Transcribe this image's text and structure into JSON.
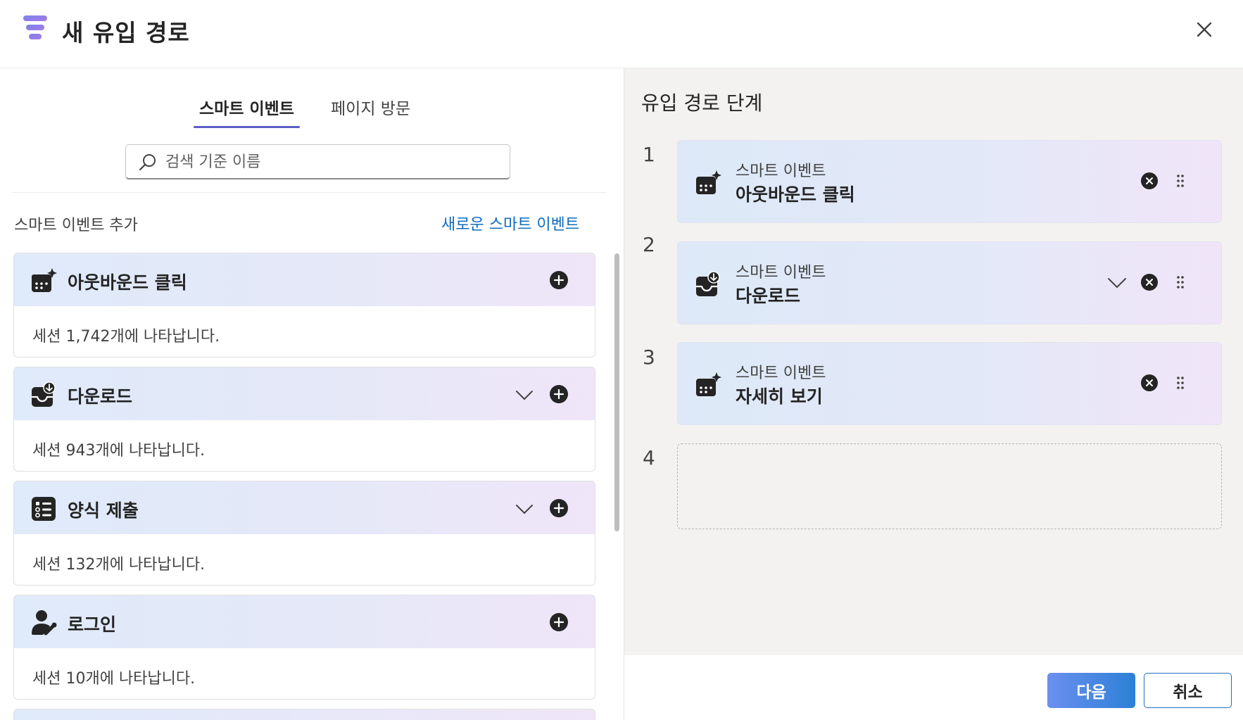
{
  "header": {
    "title": "새 유입 경로",
    "logo_icon": "funnel-icon",
    "close_icon": "close-icon"
  },
  "left_panel": {
    "tabs": [
      {
        "label": "스마트 이벤트",
        "active": true
      },
      {
        "label": "페이지 방문",
        "active": false
      }
    ],
    "search": {
      "placeholder": "검색 기준 이름",
      "value": "",
      "icon": "search-icon"
    },
    "section_label": "스마트 이벤트 추가",
    "new_link": "새로운 스마트 이벤트",
    "events": [
      {
        "title": "아웃바운드 클릭",
        "sessions": "세션 1,742개에 나타납니다.",
        "icon": "calendar-sparkle-icon",
        "expandable": false
      },
      {
        "title": "다운로드",
        "sessions": "세션 943개에 나타납니다.",
        "icon": "download-box-icon",
        "expandable": true
      },
      {
        "title": "양식 제출",
        "sessions": "세션 132개에 나타납니다.",
        "icon": "form-icon",
        "expandable": true
      },
      {
        "title": "로그인",
        "sessions": "세션 10개에 나타납니다.",
        "icon": "person-key-icon",
        "expandable": false
      }
    ]
  },
  "right_panel": {
    "title": "유입 경로 단계",
    "steps": [
      {
        "number": "1",
        "category": "스마트 이벤트",
        "title": "아웃바운드 클릭",
        "icon": "calendar-sparkle-icon",
        "expandable": false
      },
      {
        "number": "2",
        "category": "스마트 이벤트",
        "title": "다운로드",
        "icon": "download-box-icon",
        "expandable": true
      },
      {
        "number": "3",
        "category": "스마트 이벤트",
        "title": "자세히 보기",
        "icon": "calendar-sparkle-icon",
        "expandable": false
      }
    ],
    "empty_step_number": "4"
  },
  "footer": {
    "next_label": "다음",
    "cancel_label": "취소"
  },
  "colors": {
    "accent": "#5b5fc7",
    "link": "#0f6cbd",
    "primary_button_start": "#6c8ff0",
    "primary_button_end": "#2b80d6"
  }
}
